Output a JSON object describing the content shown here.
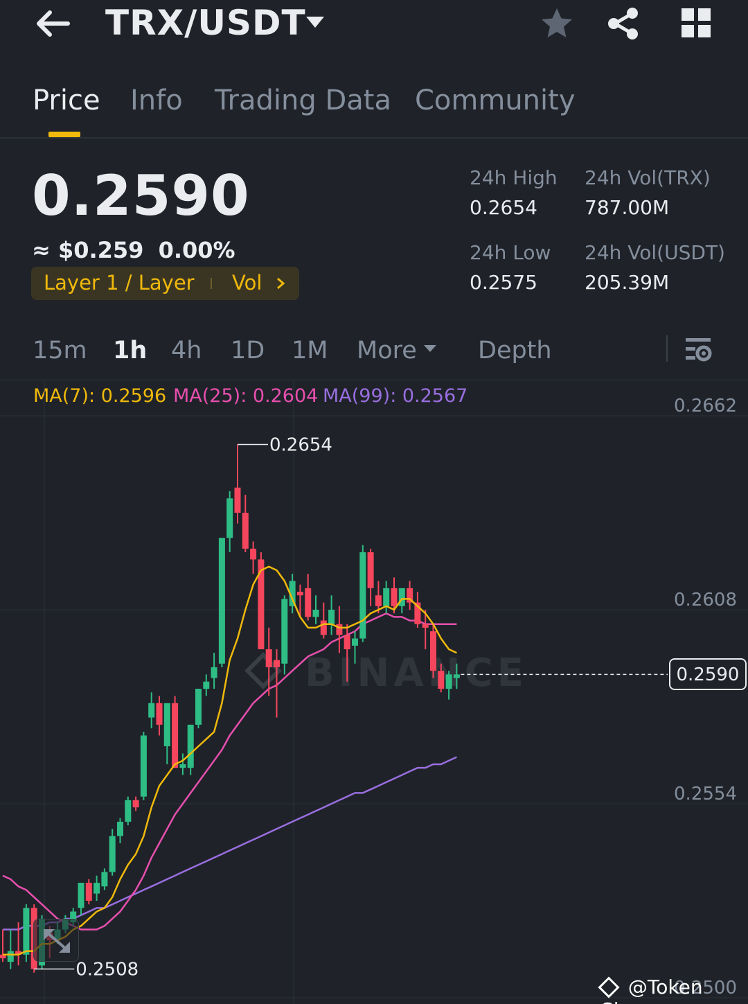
{
  "header": {
    "pair": "TRX/USDT",
    "icons": [
      "back-arrow-icon",
      "caret-down-icon",
      "star-icon",
      "share-icon",
      "grid-icon"
    ]
  },
  "tabs": [
    {
      "label": "Price",
      "active": true
    },
    {
      "label": "Info",
      "active": false
    },
    {
      "label": "Trading Data",
      "active": false
    },
    {
      "label": "Community",
      "active": false
    }
  ],
  "price": {
    "last": "0.2590",
    "fiat": "≈ $0.259",
    "change": "0.00%",
    "tag": "Layer 1 / Layer",
    "tag_vol": "Vol"
  },
  "stats": {
    "high_label": "24h High",
    "high_value": "0.2654",
    "low_label": "24h Low",
    "low_value": "0.2575",
    "vol_trx_label": "24h Vol(TRX)",
    "vol_trx_value": "787.00M",
    "vol_usdt_label": "24h Vol(USDT)",
    "vol_usdt_value": "205.39M"
  },
  "intervals": [
    {
      "label": "15m",
      "active": false
    },
    {
      "label": "1h",
      "active": true
    },
    {
      "label": "4h",
      "active": false
    },
    {
      "label": "1D",
      "active": false
    },
    {
      "label": "1M",
      "active": false
    },
    {
      "label": "More",
      "active": false
    },
    {
      "label": "Depth",
      "active": false
    }
  ],
  "ma": {
    "ma7": "MA(7): 0.2596",
    "ma25": "MA(25): 0.2604",
    "ma99": "MA(99): 0.2567"
  },
  "colors": {
    "up": "#2ebd85",
    "down": "#f6465d",
    "ma7": "#f0b90b",
    "ma25": "#e84fae",
    "ma99": "#9a6ee0",
    "accent": "#f0b90b",
    "bg": "#1f2329"
  },
  "chart_data": {
    "type": "candlestick",
    "y_ticks": [
      "0.2662",
      "0.2608",
      "0.2554",
      "0.2500"
    ],
    "ylim": [
      0.25,
      0.2662
    ],
    "current_price": "0.2590",
    "high_marker": "0.2654",
    "low_marker": "0.2508",
    "candles": [
      {
        "o": 0.2512,
        "h": 0.2519,
        "l": 0.251,
        "c": 0.2511
      },
      {
        "o": 0.251,
        "h": 0.2519,
        "l": 0.2508,
        "c": 0.2513
      },
      {
        "o": 0.2513,
        "h": 0.2521,
        "l": 0.2509,
        "c": 0.2512
      },
      {
        "o": 0.2512,
        "h": 0.2526,
        "l": 0.251,
        "c": 0.2525
      },
      {
        "o": 0.2525,
        "h": 0.2526,
        "l": 0.2507,
        "c": 0.2508
      },
      {
        "o": 0.2509,
        "h": 0.2523,
        "l": 0.2508,
        "c": 0.2522
      },
      {
        "o": 0.2518,
        "h": 0.252,
        "l": 0.2511,
        "c": 0.2516
      },
      {
        "o": 0.2516,
        "h": 0.2521,
        "l": 0.2515,
        "c": 0.2519
      },
      {
        "o": 0.2519,
        "h": 0.2523,
        "l": 0.2518,
        "c": 0.2522
      },
      {
        "o": 0.2521,
        "h": 0.2525,
        "l": 0.252,
        "c": 0.2524
      },
      {
        "o": 0.2525,
        "h": 0.2532,
        "l": 0.2523,
        "c": 0.2532
      },
      {
        "o": 0.2532,
        "h": 0.2533,
        "l": 0.2526,
        "c": 0.2527
      },
      {
        "o": 0.2529,
        "h": 0.2534,
        "l": 0.2527,
        "c": 0.2532
      },
      {
        "o": 0.2531,
        "h": 0.2536,
        "l": 0.253,
        "c": 0.2535
      },
      {
        "o": 0.2535,
        "h": 0.2547,
        "l": 0.2534,
        "c": 0.2545
      },
      {
        "o": 0.2545,
        "h": 0.255,
        "l": 0.2543,
        "c": 0.2549
      },
      {
        "o": 0.2549,
        "h": 0.2556,
        "l": 0.2548,
        "c": 0.2555
      },
      {
        "o": 0.2555,
        "h": 0.2556,
        "l": 0.2552,
        "c": 0.2553
      },
      {
        "o": 0.2556,
        "h": 0.2574,
        "l": 0.2555,
        "c": 0.2573
      },
      {
        "o": 0.2578,
        "h": 0.2585,
        "l": 0.2575,
        "c": 0.2582
      },
      {
        "o": 0.2582,
        "h": 0.2584,
        "l": 0.2573,
        "c": 0.2576
      },
      {
        "o": 0.257,
        "h": 0.2582,
        "l": 0.2565,
        "c": 0.2582
      },
      {
        "o": 0.2582,
        "h": 0.2584,
        "l": 0.2564,
        "c": 0.2564
      },
      {
        "o": 0.2564,
        "h": 0.2568,
        "l": 0.2562,
        "c": 0.2565
      },
      {
        "o": 0.2564,
        "h": 0.2576,
        "l": 0.2562,
        "c": 0.2576
      },
      {
        "o": 0.2576,
        "h": 0.2586,
        "l": 0.2575,
        "c": 0.2586
      },
      {
        "o": 0.2586,
        "h": 0.259,
        "l": 0.2584,
        "c": 0.2588
      },
      {
        "o": 0.2589,
        "h": 0.2596,
        "l": 0.2586,
        "c": 0.2592
      },
      {
        "o": 0.2593,
        "h": 0.2628,
        "l": 0.2592,
        "c": 0.2628
      },
      {
        "o": 0.2628,
        "h": 0.2641,
        "l": 0.2624,
        "c": 0.2639
      },
      {
        "o": 0.2642,
        "h": 0.2654,
        "l": 0.2632,
        "c": 0.2635
      },
      {
        "o": 0.2635,
        "h": 0.264,
        "l": 0.2624,
        "c": 0.2625
      },
      {
        "o": 0.2625,
        "h": 0.2627,
        "l": 0.2618,
        "c": 0.2622
      },
      {
        "o": 0.2622,
        "h": 0.2624,
        "l": 0.2597,
        "c": 0.2597
      },
      {
        "o": 0.2597,
        "h": 0.2603,
        "l": 0.2584,
        "c": 0.2592
      },
      {
        "o": 0.2594,
        "h": 0.2597,
        "l": 0.2578,
        "c": 0.2592
      },
      {
        "o": 0.2593,
        "h": 0.2612,
        "l": 0.259,
        "c": 0.2611
      },
      {
        "o": 0.2609,
        "h": 0.2618,
        "l": 0.2607,
        "c": 0.2616
      },
      {
        "o": 0.2613,
        "h": 0.2615,
        "l": 0.2606,
        "c": 0.2612
      },
      {
        "o": 0.2614,
        "h": 0.2618,
        "l": 0.2605,
        "c": 0.2606
      },
      {
        "o": 0.2606,
        "h": 0.2612,
        "l": 0.2604,
        "c": 0.2608
      },
      {
        "o": 0.2605,
        "h": 0.261,
        "l": 0.26,
        "c": 0.2601
      },
      {
        "o": 0.2604,
        "h": 0.2612,
        "l": 0.2601,
        "c": 0.2608
      },
      {
        "o": 0.2604,
        "h": 0.2609,
        "l": 0.2596,
        "c": 0.2601
      },
      {
        "o": 0.2601,
        "h": 0.2604,
        "l": 0.2588,
        "c": 0.2597
      },
      {
        "o": 0.2598,
        "h": 0.2602,
        "l": 0.2593,
        "c": 0.26
      },
      {
        "o": 0.26,
        "h": 0.2626,
        "l": 0.2599,
        "c": 0.2624
      },
      {
        "o": 0.2624,
        "h": 0.2625,
        "l": 0.2609,
        "c": 0.2614
      },
      {
        "o": 0.2612,
        "h": 0.2616,
        "l": 0.2607,
        "c": 0.2609
      },
      {
        "o": 0.2609,
        "h": 0.2616,
        "l": 0.2607,
        "c": 0.2614
      },
      {
        "o": 0.2614,
        "h": 0.2617,
        "l": 0.2607,
        "c": 0.2609
      },
      {
        "o": 0.2609,
        "h": 0.2614,
        "l": 0.2607,
        "c": 0.2614
      },
      {
        "o": 0.2614,
        "h": 0.2616,
        "l": 0.2608,
        "c": 0.261
      },
      {
        "o": 0.261,
        "h": 0.2613,
        "l": 0.2603,
        "c": 0.2604
      },
      {
        "o": 0.2604,
        "h": 0.2608,
        "l": 0.2597,
        "c": 0.2603
      },
      {
        "o": 0.2602,
        "h": 0.2604,
        "l": 0.2589,
        "c": 0.2591
      },
      {
        "o": 0.2591,
        "h": 0.2593,
        "l": 0.2585,
        "c": 0.2586
      },
      {
        "o": 0.2586,
        "h": 0.2591,
        "l": 0.2583,
        "c": 0.259
      },
      {
        "o": 0.2589,
        "h": 0.2593,
        "l": 0.2586,
        "c": 0.259
      }
    ],
    "ma7_points": [
      0.2512,
      0.2512,
      0.2512,
      0.2513,
      0.2513,
      0.2515,
      0.2515,
      0.2516,
      0.2517,
      0.2519,
      0.252,
      0.2522,
      0.2524,
      0.2525,
      0.2528,
      0.2533,
      0.2537,
      0.254,
      0.2545,
      0.2553,
      0.2559,
      0.2562,
      0.2565,
      0.2566,
      0.2568,
      0.257,
      0.2572,
      0.2574,
      0.2582,
      0.2594,
      0.26,
      0.2608,
      0.2615,
      0.2619,
      0.262,
      0.2619,
      0.2616,
      0.2611,
      0.2606,
      0.2603,
      0.2603,
      0.2604,
      0.2604,
      0.2603,
      0.2603,
      0.2604,
      0.2605,
      0.2607,
      0.2608,
      0.2609,
      0.2608,
      0.2611,
      0.2611,
      0.2609,
      0.2607,
      0.2604,
      0.26,
      0.2597,
      0.2596
    ],
    "ma25_points": [
      0.2534,
      0.2533,
      0.2531,
      0.253,
      0.2528,
      0.2526,
      0.2524,
      0.2522,
      0.2521,
      0.252,
      0.2519,
      0.2519,
      0.2519,
      0.252,
      0.2522,
      0.2524,
      0.2527,
      0.253,
      0.2534,
      0.2539,
      0.2543,
      0.2547,
      0.2551,
      0.2554,
      0.2557,
      0.256,
      0.2563,
      0.2566,
      0.2569,
      0.2573,
      0.2576,
      0.2579,
      0.2582,
      0.2584,
      0.2586,
      0.2587,
      0.2589,
      0.2591,
      0.2593,
      0.2595,
      0.2596,
      0.2597,
      0.2599,
      0.26,
      0.2601,
      0.2602,
      0.2604,
      0.2605,
      0.2606,
      0.2607,
      0.2606,
      0.2606,
      0.2605,
      0.2605,
      0.2604,
      0.2604,
      0.2604,
      0.2604,
      0.2604
    ],
    "ma99_points": [
      0.2519,
      0.2519,
      0.2519,
      0.252,
      0.252,
      0.252,
      0.2521,
      0.2521,
      0.2522,
      0.2522,
      0.2523,
      0.2524,
      0.2525,
      0.2525,
      0.2526,
      0.2527,
      0.2528,
      0.2529,
      0.253,
      0.2531,
      0.2532,
      0.2533,
      0.2534,
      0.2535,
      0.2536,
      0.2537,
      0.2538,
      0.2539,
      0.254,
      0.2541,
      0.2542,
      0.2543,
      0.2544,
      0.2545,
      0.2546,
      0.2547,
      0.2548,
      0.2549,
      0.255,
      0.2551,
      0.2552,
      0.2553,
      0.2554,
      0.2555,
      0.2556,
      0.2557,
      0.2557,
      0.2558,
      0.2559,
      0.256,
      0.2561,
      0.2562,
      0.2563,
      0.2564,
      0.2564,
      0.2565,
      0.2565,
      0.2566,
      0.2567
    ]
  },
  "watermark": "@Token Slayer"
}
